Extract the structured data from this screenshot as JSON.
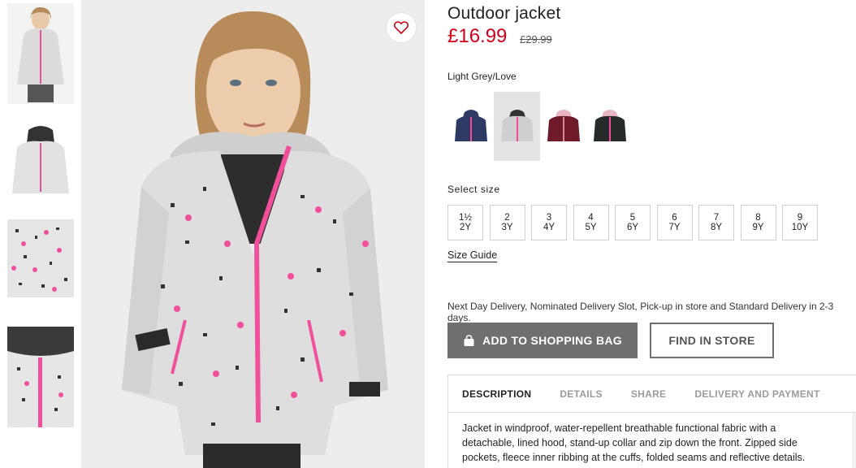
{
  "product": {
    "title": "Outdoor jacket",
    "price": "£16.99",
    "old_price": "£29.99",
    "color_name": "Light Grey/Love",
    "colors": {
      "accent_price": "#d0021b",
      "button_bg": "#6f6f6f"
    }
  },
  "thumbnails": [
    {
      "icon": "girl-front-photo"
    },
    {
      "icon": "jacket-flat-photo"
    },
    {
      "icon": "fabric-detail-photo"
    },
    {
      "icon": "hood-detail-photo"
    }
  ],
  "swatches": [
    {
      "color": "#2e3a63",
      "selected": false
    },
    {
      "color": "#c9c9c9",
      "selected": true
    },
    {
      "color": "#6e1a2b",
      "selected": false
    },
    {
      "color": "#262a2a",
      "selected": false
    }
  ],
  "size_section": {
    "label": "Select size",
    "sizes": [
      {
        "top": "1½",
        "bottom": "2Y"
      },
      {
        "top": "2",
        "bottom": "3Y"
      },
      {
        "top": "3",
        "bottom": "4Y"
      },
      {
        "top": "4",
        "bottom": "5Y"
      },
      {
        "top": "5",
        "bottom": "6Y"
      },
      {
        "top": "6",
        "bottom": "7Y"
      },
      {
        "top": "7",
        "bottom": "8Y"
      },
      {
        "top": "8",
        "bottom": "9Y"
      },
      {
        "top": "9",
        "bottom": "10Y"
      }
    ],
    "guide_label": "Size Guide"
  },
  "delivery_text": "Next Day Delivery, Nominated Delivery Slot, Pick-up in store and Standard Delivery in 2-3 days.",
  "buttons": {
    "add_to_bag": "ADD TO SHOPPING BAG",
    "find_in_store": "FIND IN STORE"
  },
  "tabs": [
    {
      "label": "DESCRIPTION",
      "active": true
    },
    {
      "label": "DETAILS",
      "active": false
    },
    {
      "label": "SHARE",
      "active": false
    },
    {
      "label": "DELIVERY AND PAYMENT",
      "active": false
    }
  ],
  "description": "Jacket in windproof, water-repellent breathable functional fabric with a detachable, lined hood, stand-up collar and zip down the front. Zipped side pockets, fleece inner ribbing at the cuffs, folded seams and reflective details."
}
